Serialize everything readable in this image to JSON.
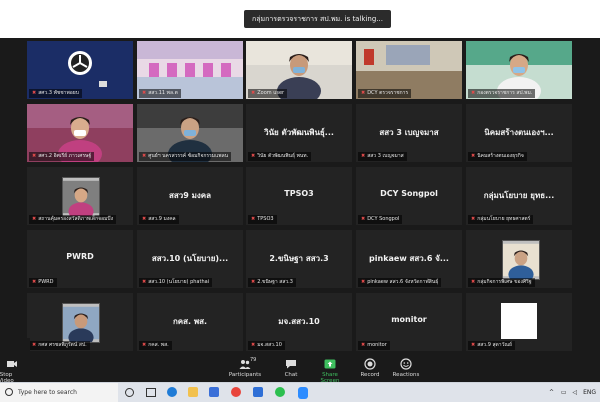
{
  "meeting": {
    "speaker_banner": "กลุ่มการตรวจราชการ สป.พม. is talking..."
  },
  "tiles": [
    {
      "label": "สศว.3 พัชชาพอยบ",
      "center": "",
      "kind": "logo"
    },
    {
      "label": "สสว.11 พล.ต",
      "center": "",
      "kind": "room-pink"
    },
    {
      "label": "Zoom user",
      "center": "",
      "kind": "person-room"
    },
    {
      "label": "DCY ตรวจราชการ",
      "center": "",
      "kind": "room-office"
    },
    {
      "label": "กองตรวจราชการ สป.พม.",
      "center": "",
      "kind": "person-mask"
    },
    {
      "label": "สศว.2 อิศเรีย์ ภาวเศรษฐ์",
      "center": "",
      "kind": "person-mask-pink"
    },
    {
      "label": "ศูนย์ฯ นครสวรรค์ ซ้อมกิจกรรมแพลน",
      "center": "",
      "kind": "person-room2"
    },
    {
      "label": "วินัย ตัวพัฒนพินธุ์ พนท.",
      "center": "วินัย ตัวพัฒนพินธุ์...",
      "kind": "name"
    },
    {
      "label": "สสว 3 เบญจมาส",
      "center": "สสว 3 เบญจมาส",
      "kind": "name"
    },
    {
      "label": "นิคมสร้างตนเองธุรกิจ",
      "center": "นิคมสร้างตนเองฯ...",
      "kind": "name"
    },
    {
      "label": "สถานคุ้มครองสวัสดิภาพเด็กจอมบึง",
      "center": "",
      "kind": "person-small"
    },
    {
      "label": "สสว.9 มงคล",
      "center": "สสว9 มงคล",
      "kind": "name"
    },
    {
      "label": "TPSO3",
      "center": "TPSO3",
      "kind": "name"
    },
    {
      "label": "DCY Songpol",
      "center": "DCY Songpol",
      "kind": "name"
    },
    {
      "label": "กลุ่มนโยบาย ยุทธศาสตร์",
      "center": "กลุ่มนโยบาย ยุทธ...",
      "kind": "name"
    },
    {
      "label": "PWRD",
      "center": "PWRD",
      "kind": "name"
    },
    {
      "label": "สสว.10 (นโยบาย) phathai",
      "center": "สสว.10 (นโยบาย)...",
      "kind": "name"
    },
    {
      "label": "2.ขนิษฐา สสว.3",
      "center": "2.ขนิษฐา สสว.3",
      "kind": "name"
    },
    {
      "label": "pinkaew สสว.6 จังหวัดกาฬสินธุ์",
      "center": "pinkaew สสว.6 จั...",
      "kind": "name"
    },
    {
      "label": "กลุ่มกิจการพิเศษ ของศิริฐ",
      "center": "",
      "kind": "person-small2"
    },
    {
      "label": "กศส ศรชลพิภูรัตน์ สป.",
      "center": "",
      "kind": "person-small3"
    },
    {
      "label": "กคส. พส.",
      "center": "กคส. พส.",
      "kind": "name"
    },
    {
      "label": "มจ.สสว.10",
      "center": "มจ.สสว.10",
      "kind": "name"
    },
    {
      "label": "monitor",
      "center": "monitor",
      "kind": "name"
    },
    {
      "label": "สสว.9 สุดาวัณย์",
      "center": "",
      "kind": "white-box"
    }
  ],
  "toolbar": {
    "stop_video": "Stop Video",
    "participants": "Participants",
    "participants_count": "79",
    "chat": "Chat",
    "share_screen": "Share Screen",
    "record": "Record",
    "reactions": "Reactions"
  },
  "taskbar": {
    "search_placeholder": "Type here to search",
    "lang": "ENG"
  },
  "colors": {
    "share_green": "#3fbf5f",
    "mic_red": "#e24b4b",
    "tile_bg": "#232323"
  }
}
